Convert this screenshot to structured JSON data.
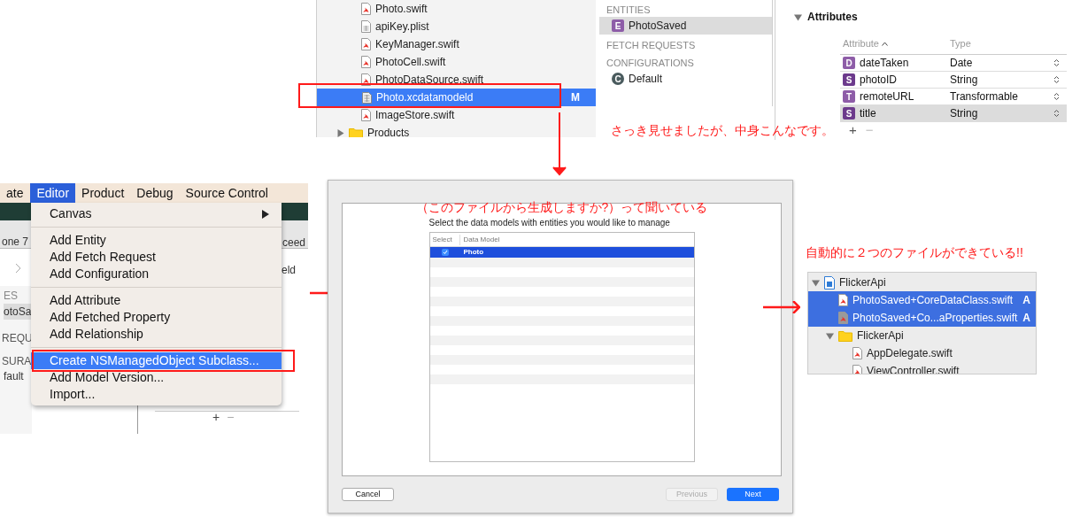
{
  "navigator": {
    "items": [
      {
        "name": "Photo.swift",
        "kind": "swift",
        "selected": false
      },
      {
        "name": "apiKey.plist",
        "kind": "plist",
        "selected": false
      },
      {
        "name": "KeyManager.swift",
        "kind": "swift",
        "selected": false
      },
      {
        "name": "PhotoCell.swift",
        "kind": "swift",
        "selected": false
      },
      {
        "name": "PhotoDataSource.swift",
        "kind": "swift",
        "selected": false
      },
      {
        "name": "Photo.xcdatamodeld",
        "kind": "datamodel",
        "selected": true,
        "badge": "M"
      },
      {
        "name": "ImageStore.swift",
        "kind": "swift",
        "selected": false
      },
      {
        "name": "Products",
        "kind": "folder",
        "selected": false,
        "expanded": false
      }
    ]
  },
  "entities_panel": {
    "sections": [
      {
        "title": "ENTITIES",
        "items": [
          {
            "icon": "E",
            "name": "PhotoSaved",
            "selected": true
          }
        ]
      },
      {
        "title": "FETCH REQUESTS"
      },
      {
        "title": "CONFIGURATIONS",
        "items": [
          {
            "icon": "C",
            "name": "Default",
            "selected": false
          }
        ]
      }
    ]
  },
  "attributes": {
    "title": "Attributes",
    "expanded": true,
    "columns": [
      {
        "label": "Attribute",
        "sorted": true
      },
      {
        "label": "Type",
        "sorted": false
      }
    ],
    "rows": [
      {
        "icon": "D",
        "name": "dateTaken",
        "type": "Date",
        "selected": false
      },
      {
        "icon": "S",
        "name": "photoID",
        "type": "String",
        "selected": false
      },
      {
        "icon": "T",
        "name": "remoteURL",
        "type": "Transformable",
        "selected": false
      },
      {
        "icon": "S",
        "name": "title",
        "type": "String",
        "selected": true
      }
    ],
    "buttons": [
      "+",
      "−"
    ]
  },
  "note_top": "さっき見せましたが、中身こんなです。",
  "menu": {
    "menubar": [
      {
        "label": "ate",
        "selected": false
      },
      {
        "label": "Editor",
        "selected": true
      },
      {
        "label": "Product",
        "selected": false
      },
      {
        "label": "Debug",
        "selected": false
      },
      {
        "label": "Source Control",
        "selected": false
      }
    ],
    "background_texts": [
      "one 7",
      "ceed",
      "eld",
      "ES",
      "otoSa",
      "REQU",
      "SURA",
      "fault"
    ],
    "background_buttons": [
      "+",
      "−"
    ],
    "items": [
      {
        "kind": "item",
        "label": "Canvas",
        "submenu": true,
        "highlighted": false
      },
      {
        "kind": "separator"
      },
      {
        "kind": "item",
        "label": "Add Entity",
        "submenu": false,
        "highlighted": false
      },
      {
        "kind": "item",
        "label": "Add Fetch Request",
        "submenu": false,
        "highlighted": false
      },
      {
        "kind": "item",
        "label": "Add Configuration",
        "submenu": false,
        "highlighted": false
      },
      {
        "kind": "separator"
      },
      {
        "kind": "item",
        "label": "Add Attribute",
        "submenu": false,
        "highlighted": false
      },
      {
        "kind": "item",
        "label": "Add Fetched Property",
        "submenu": false,
        "highlighted": false
      },
      {
        "kind": "item",
        "label": "Add Relationship",
        "submenu": false,
        "highlighted": false
      },
      {
        "kind": "separator"
      },
      {
        "kind": "item",
        "label": "Create NSManagedObject Subclass...",
        "submenu": false,
        "highlighted": true
      },
      {
        "kind": "item",
        "label": "Add Model Version...",
        "submenu": false,
        "highlighted": false
      },
      {
        "kind": "item",
        "label": "Import...",
        "submenu": false,
        "highlighted": false
      }
    ]
  },
  "dialog": {
    "note": "（このファイルから生成しますか?）って聞いている",
    "prompt": "Select the data models with entities you would like to manage",
    "table": {
      "columns": [
        "Select",
        "Data Model"
      ],
      "rows": [
        {
          "checked": true,
          "name": "Photo",
          "selected": true
        }
      ]
    },
    "buttons": [
      {
        "label": "Cancel",
        "kind": "normal",
        "disabled": false
      },
      {
        "label": "Previous",
        "kind": "normal",
        "disabled": true
      },
      {
        "label": "Next",
        "kind": "default",
        "disabled": false
      }
    ]
  },
  "project_tree": {
    "note": "自動的に２つのファイルができている!!",
    "items": [
      {
        "name": "FlickerApi",
        "kind": "project",
        "expanded": true,
        "selected": false,
        "children": [
          {
            "name": "PhotoSaved+CoreDataClass.swift",
            "kind": "swift",
            "badge": "A",
            "selected": true
          },
          {
            "name": "PhotoSaved+Co...aProperties.swift",
            "kind": "swift-generated",
            "badge": "A",
            "selected": true
          },
          {
            "name": "FlickerApi",
            "kind": "folder",
            "expanded": true,
            "selected": false,
            "children": [
              {
                "name": "AppDelegate.swift",
                "kind": "swift",
                "selected": false
              },
              {
                "name": "ViewController.swift",
                "kind": "swift",
                "selected": false
              }
            ]
          }
        ]
      }
    ]
  }
}
